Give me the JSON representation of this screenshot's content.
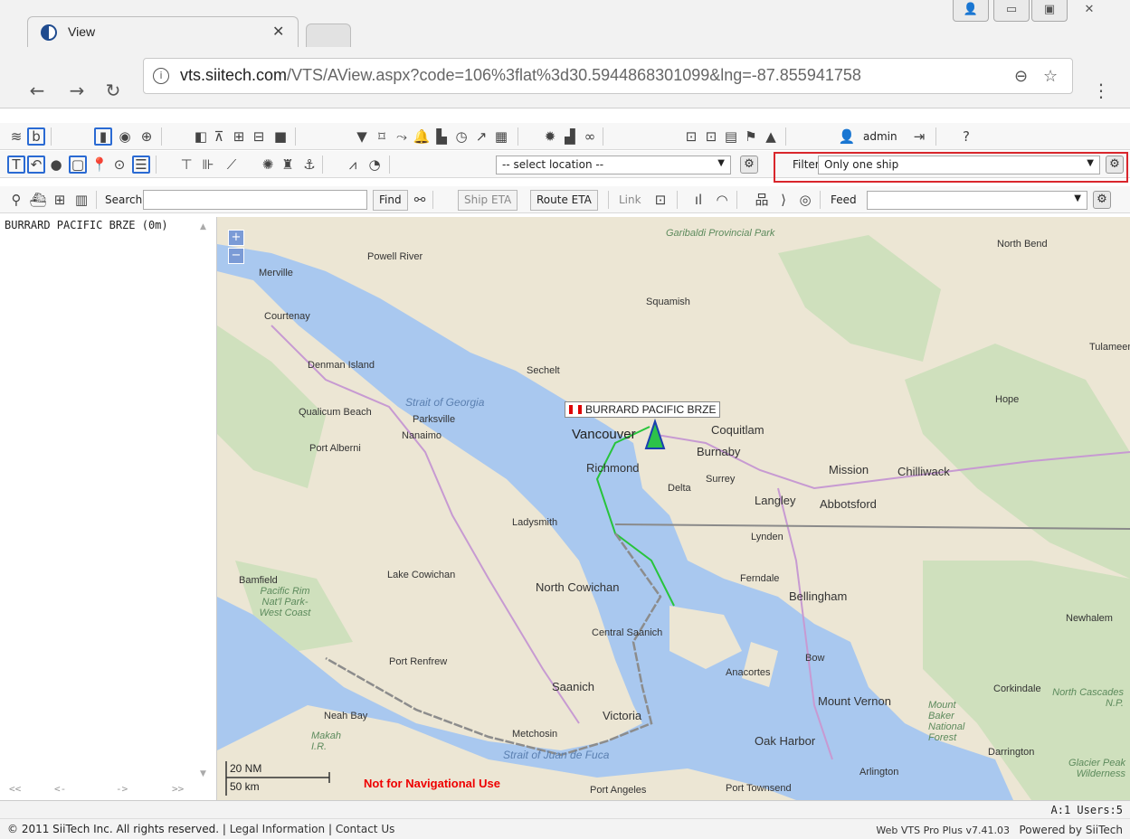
{
  "browser": {
    "tab_title": "View",
    "url_domain": "vts.siitech.com",
    "url_path": "/VTS/AView.aspx?code=106%3flat%3d30.5944868301099&lng=-87.855941758"
  },
  "toolbar": {
    "admin_label": "admin",
    "location_select": "-- select location --",
    "filter_label": "Filter",
    "filter_value": "Only one ship",
    "search_label": "Search",
    "search_value": "",
    "find_button": "Find",
    "ship_eta_button": "Ship ETA",
    "route_eta_button": "Route ETA",
    "link_label": "Link",
    "feed_label": "Feed",
    "feed_value": ""
  },
  "sidebar": {
    "items": [
      {
        "label": "BURRARD PACIFIC BRZE (0m)"
      }
    ],
    "pager": [
      "<<",
      "<-",
      "->",
      ">>"
    ]
  },
  "map": {
    "ship_label": "BURRARD PACIFIC BRZE",
    "zoom_in": "+",
    "zoom_out": "−",
    "scale_nm": "20 NM",
    "scale_km": "50 km",
    "warning": "Not for Navigational Use",
    "places": [
      "Powell River",
      "Merville",
      "Courtenay",
      "Denman Island",
      "Qualicum Beach",
      "Parksville",
      "Nanaimo",
      "Port Alberni",
      "Sechelt",
      "Squamish",
      "Vancouver",
      "Coquitlam",
      "Burnaby",
      "Richmond",
      "Surrey",
      "Delta",
      "Langley",
      "Abbotsford",
      "Mission",
      "Chilliwack",
      "Hope",
      "North Bend",
      "Tulameen",
      "Ladysmith",
      "Lynden",
      "Bamfield",
      "Lake Cowichan",
      "North Cowichan",
      "Ferndale",
      "Bellingham",
      "Central Saanich",
      "Port Renfrew",
      "Saanich",
      "Victoria",
      "Anacortes",
      "Bow",
      "Newhalem",
      "Corkindale",
      "Mount Vernon",
      "Neah Bay",
      "Metchosin",
      "Oak Harbor",
      "Darrington",
      "Arlington",
      "Port Angeles",
      "Port Townsend"
    ],
    "water_labels": [
      "Strait of Georgia",
      "Strait of Juan de Fuca"
    ],
    "park_labels": [
      "Garibaldi Provincial Park",
      "Pacific Rim Nat'l Park-West Coast",
      "Mount Baker National Forest",
      "North Cascades N.P.",
      "Glacier Peak Wilderness",
      "Makah I.R."
    ]
  },
  "status": {
    "text": "A:1 Users:5"
  },
  "footer": {
    "copyright": "© 2011 SiiTech Inc. All rights reserved.",
    "legal": "Legal Information",
    "contact": "Contact Us",
    "version": "Web VTS Pro Plus v7.41.03",
    "powered": "Powered by SiiTech"
  }
}
